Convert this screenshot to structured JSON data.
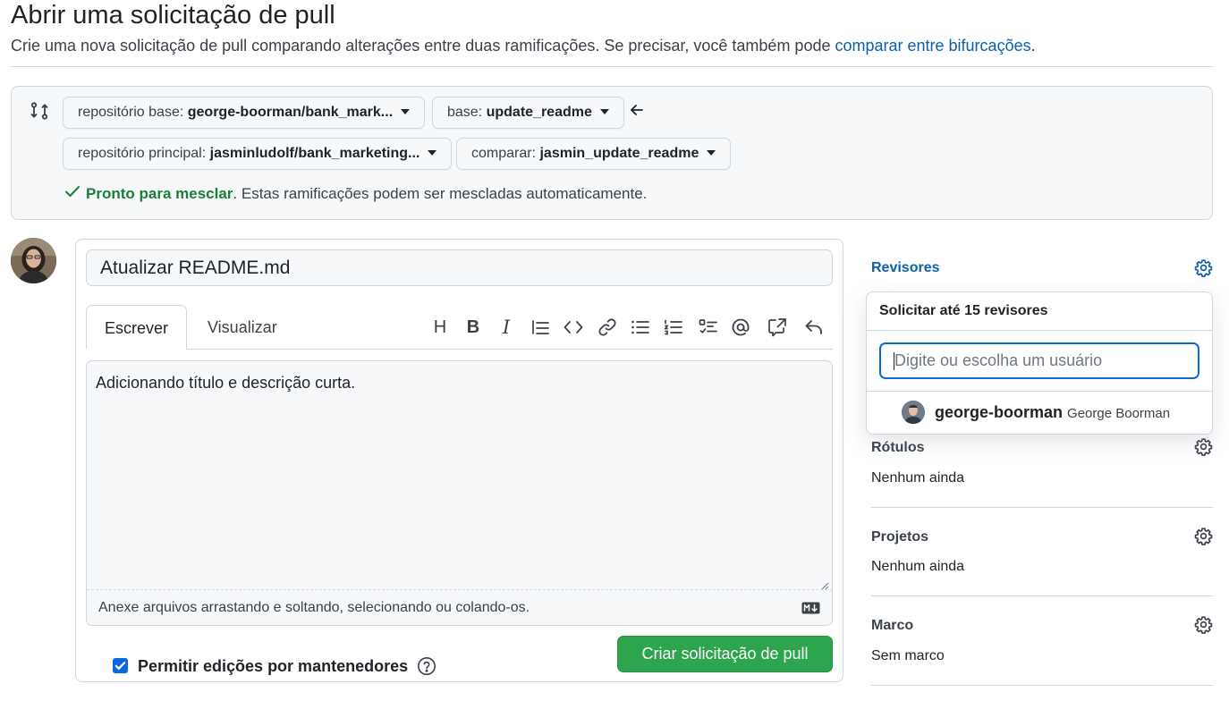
{
  "header": {
    "title": "Abrir uma solicitação de pull",
    "subtitle_prefix": "Crie uma nova solicitação de pull comparando alterações entre duas ramificações. Se precisar, você também pode ",
    "subtitle_link": "comparar entre bifurcações",
    "subtitle_suffix": "."
  },
  "compare": {
    "base_repo_label": "repositório base:",
    "base_repo_value": "george-boorman/bank_mark...",
    "base_branch_label": "base:",
    "base_branch_value": "update_readme",
    "head_repo_label": "repositório principal:",
    "head_repo_value": "jasminludolf/bank_marketing...",
    "compare_branch_label": "comparar:",
    "compare_branch_value": "jasmin_update_readme",
    "status_ok": "Pronto para mesclar",
    "status_text": ". Estas ramificações podem ser mescladas automaticamente."
  },
  "form": {
    "title_value": "Atualizar README.md",
    "tab_write": "Escrever",
    "tab_preview": "Visualizar",
    "body_value": "Adicionando título e descrição curta.",
    "attach_hint": "Anexe arquivos arrastando e soltando, selecionando ou colando-os.",
    "allow_edits_label": "Permitir edições por mantenedores",
    "allow_edits_checked": true,
    "create_button": "Criar solicitação de pull"
  },
  "toolbar": {
    "icons": [
      "heading-icon",
      "bold-icon",
      "italic-icon",
      "quote-icon",
      "code-icon",
      "link-icon",
      "unordered-list-icon",
      "ordered-list-icon",
      "task-list-icon",
      "mention-icon",
      "cross-reference-icon",
      "reply-icon"
    ],
    "heading_glyph": "H",
    "bold_glyph": "B",
    "italic_glyph": "I"
  },
  "sidebar": {
    "reviewers_title": "Revisores",
    "reviewers_dropdown": {
      "title": "Solicitar até 15 revisores",
      "placeholder": "Digite ou escolha um usuário",
      "user_login": "george-boorman",
      "user_name": "George Boorman"
    },
    "labels_title": "Rótulos",
    "labels_value": "Nenhum ainda",
    "projects_title": "Projetos",
    "projects_value": "Nenhum ainda",
    "milestone_title": "Marco",
    "milestone_value": "Sem marco"
  },
  "colors": {
    "accent_blue": "#0969da",
    "link_blue": "#0b5fae",
    "success_green": "#1a7f37",
    "button_green": "#2da44e",
    "border": "#d0d7de",
    "canvas_subtle": "#f6f8fa"
  }
}
